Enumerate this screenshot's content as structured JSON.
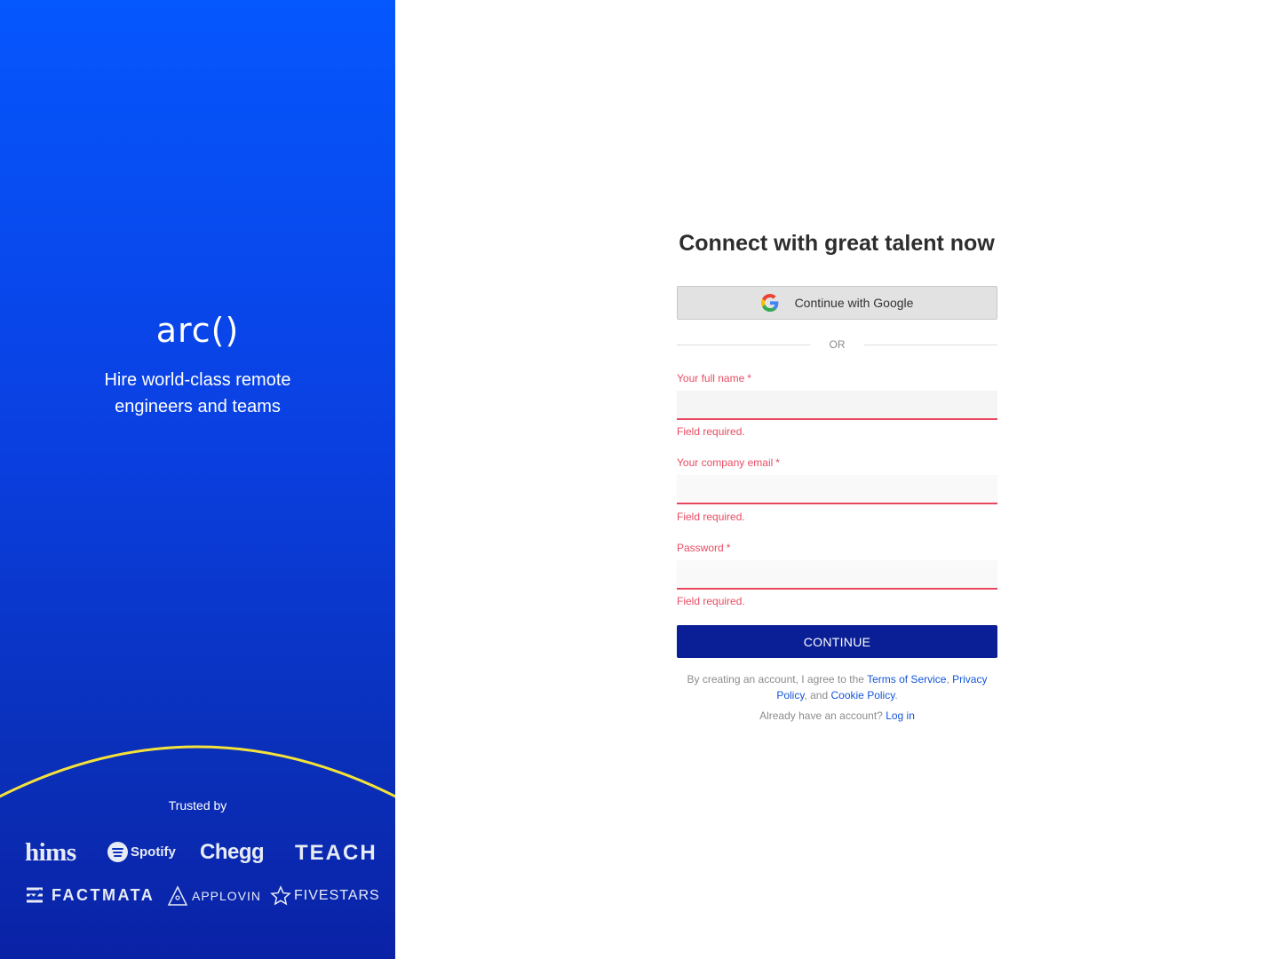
{
  "left_panel": {
    "logo_text": "arc()",
    "tagline": "Hire world-class remote engineers and teams",
    "trusted_label": "Trusted by",
    "arc_color": "#f4e23a",
    "brands": [
      "hims",
      "Spotify",
      "Chegg",
      "TEACH",
      "FACTMATA",
      "APPLOVIN",
      "FIVESTARS"
    ]
  },
  "form": {
    "title": "Connect with great talent now",
    "google_label": "Continue with Google",
    "or_label": "OR",
    "fields": [
      {
        "label": "Your full name",
        "required": "*",
        "value": "",
        "error": "Field required."
      },
      {
        "label": "Your company email",
        "required": "*",
        "value": "",
        "error": "Field required."
      },
      {
        "label": "Password",
        "required": "*",
        "value": "",
        "error": "Field required."
      }
    ],
    "continue_label": "CONTINUE",
    "terms": {
      "prefix": "By creating an account, I agree to the",
      "terms_link": "Terms of Service",
      "sep1": ",",
      "privacy_link": "Privacy Policy",
      "sep2": ", and",
      "cookie_link": "Cookie Policy",
      "suffix": "."
    },
    "login": {
      "prefix": "Already have an account?",
      "link": "Log in"
    }
  },
  "colors": {
    "brand_blue": "#0557fe",
    "button_navy": "#0a1f96",
    "error_red": "#e94c62",
    "link_blue": "#1455d9"
  }
}
